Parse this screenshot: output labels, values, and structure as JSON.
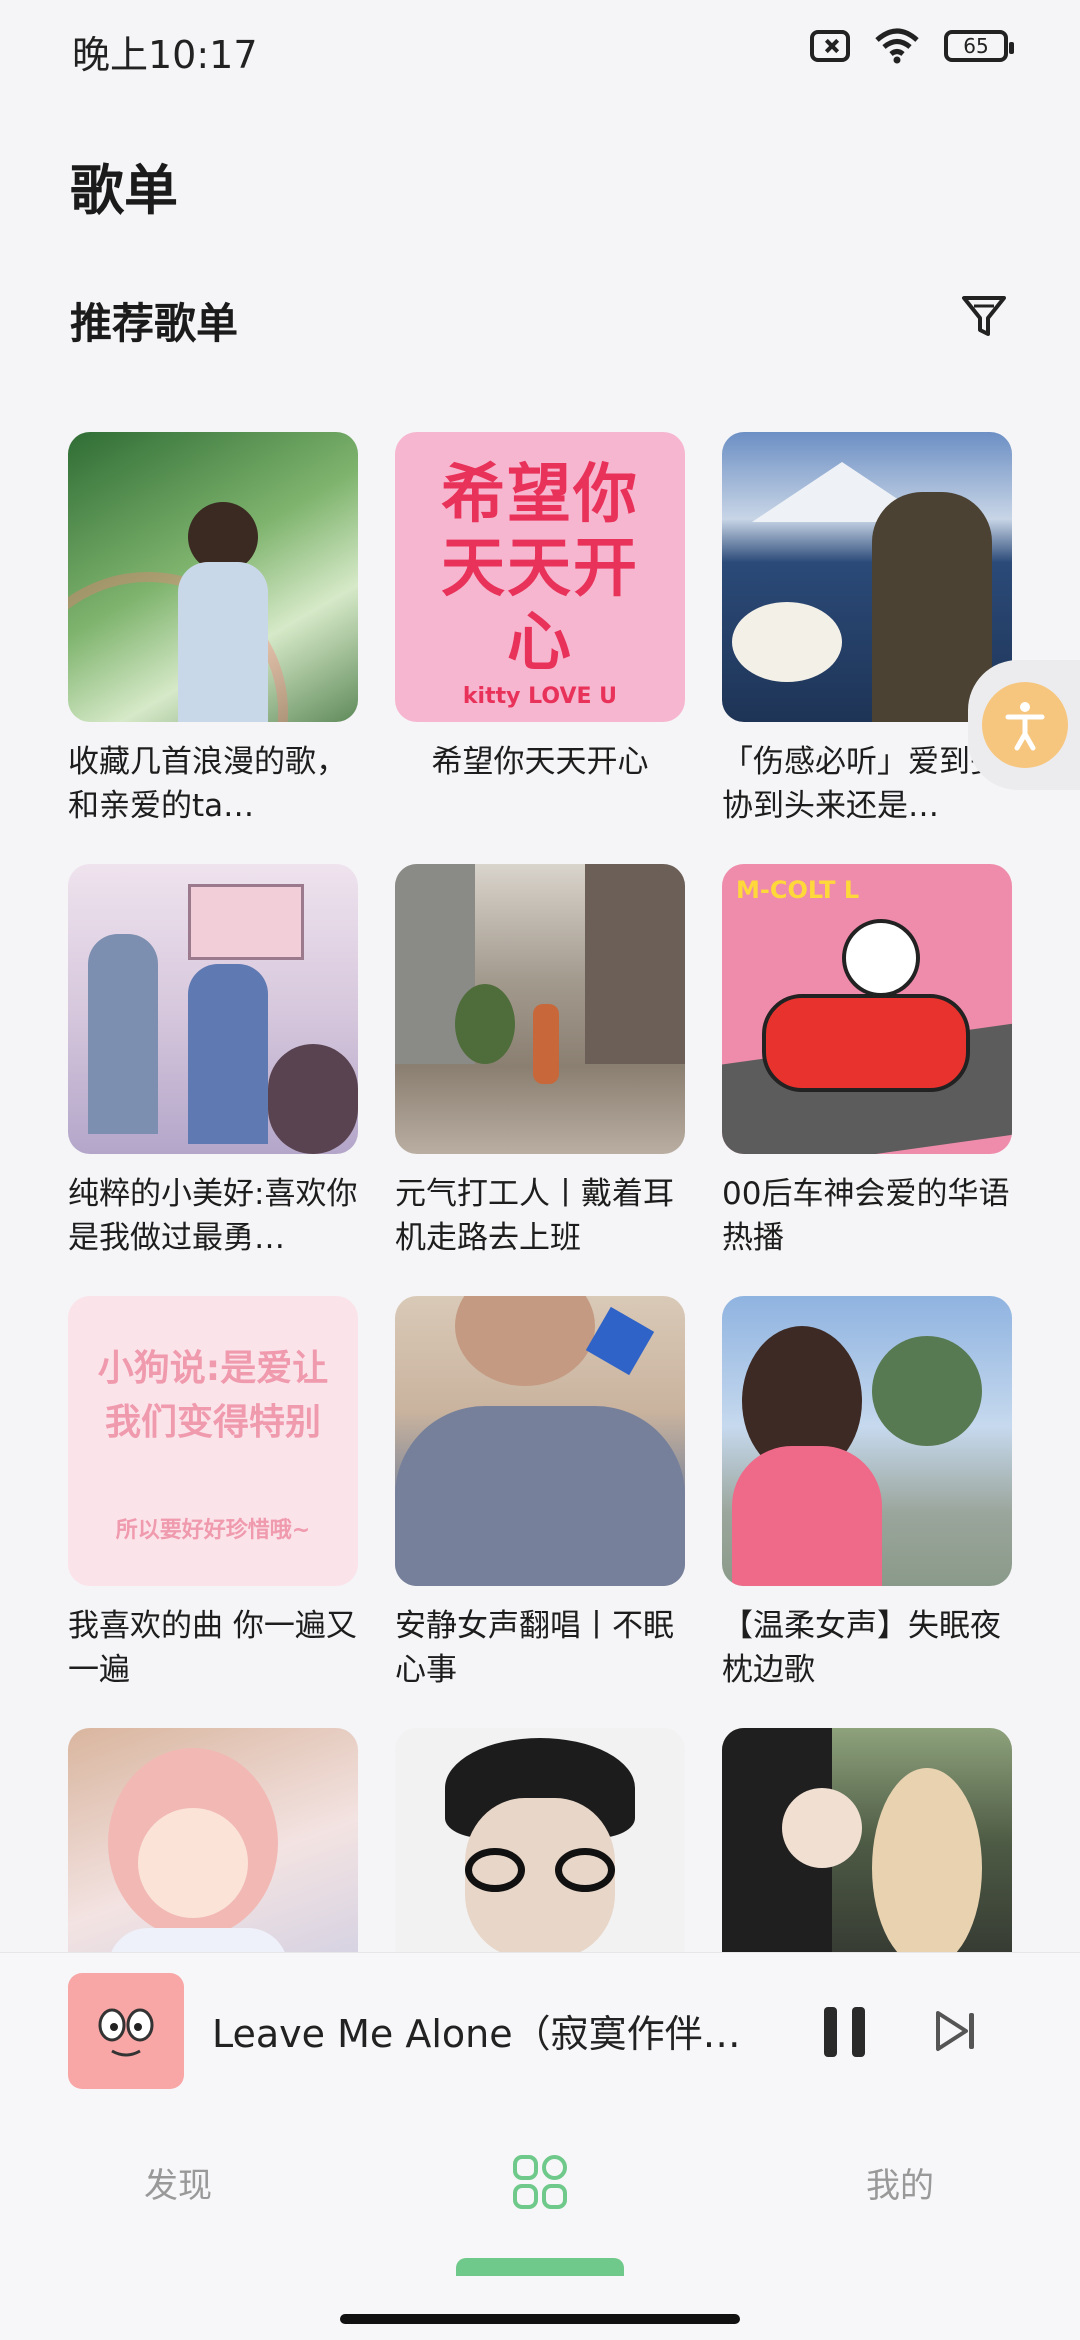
{
  "status_bar": {
    "time": "晚上10:17",
    "battery": "65"
  },
  "header": {
    "title": "歌单"
  },
  "section": {
    "title": "推荐歌单"
  },
  "playlists": [
    {
      "title": "收藏几首浪漫的歌，和亲爱的ta…"
    },
    {
      "title": "希望你天天开心",
      "cover_text": "希望你天天开心",
      "cover_subtext": "kitty LOVE U"
    },
    {
      "title": "「伤感必听」爱到妥协到头来还是…"
    },
    {
      "title": "纯粹的小美好:喜欢你 是我做过最勇…"
    },
    {
      "title": "元气打工人丨戴着耳机走路去上班"
    },
    {
      "title": "00后车神会爱的华语热播",
      "cover_text": "M-COLT L"
    },
    {
      "title": "我喜欢的曲 你一遍又一遍",
      "cover_text": "小狗说:是爱让我们变得特别",
      "cover_subtext": "所以要好好珍惜哦~"
    },
    {
      "title": "安静女声翻唱丨不眠心事"
    },
    {
      "title": "【温柔女声】失眠夜枕边歌"
    },
    {
      "title": ""
    },
    {
      "title": ""
    },
    {
      "title": ""
    }
  ],
  "player": {
    "title": "Leave Me Alone（寂寞作伴…"
  },
  "nav": {
    "discover": "发现",
    "mine": "我的"
  },
  "colors": {
    "accent": "#6fc98b",
    "mini_cover": "#f8a6a6",
    "float": "#f7c67e"
  }
}
